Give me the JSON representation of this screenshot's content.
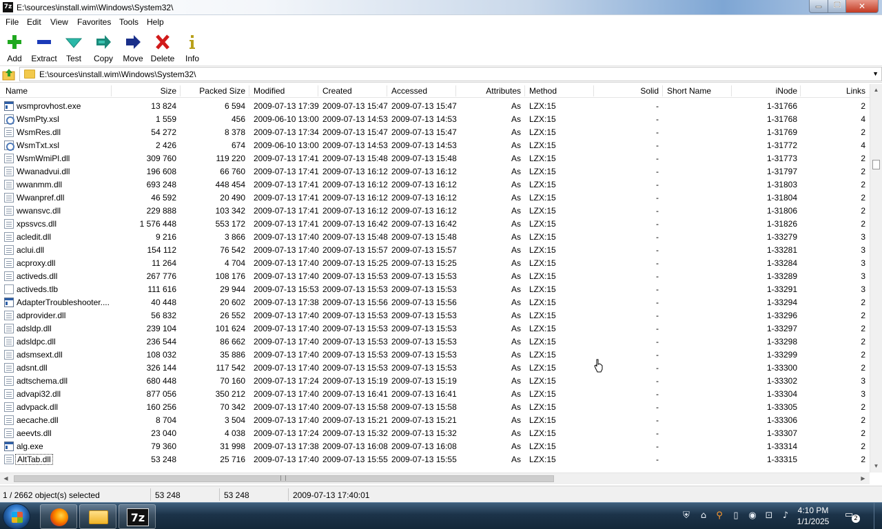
{
  "window": {
    "app_icon": "7z",
    "title": "E:\\sources\\install.wim\\Windows\\System32\\",
    "minimize_icon": "minimize-icon",
    "maximize_icon": "maximize-icon",
    "close_glyph": "✕"
  },
  "menu": [
    "File",
    "Edit",
    "View",
    "Favorites",
    "Tools",
    "Help"
  ],
  "toolbar": [
    {
      "label": "Add",
      "icon": "plus-icon",
      "color": "#1fa81f"
    },
    {
      "label": "Extract",
      "icon": "minus-icon",
      "color": "#1a3ab8"
    },
    {
      "label": "Test",
      "icon": "check-icon",
      "color": "#2ab8a8"
    },
    {
      "label": "Copy",
      "icon": "double-arrow-icon",
      "color": "#1a8a7a"
    },
    {
      "label": "Move",
      "icon": "arrow-right-icon",
      "color": "#1a2f8a"
    },
    {
      "label": "Delete",
      "icon": "x-icon",
      "color": "#d11a1a"
    },
    {
      "label": "Info",
      "icon": "info-icon",
      "color": "#b8a01a"
    }
  ],
  "address": {
    "path": "E:\\sources\\install.wim\\Windows\\System32\\",
    "dropdown_glyph": "▼"
  },
  "columns": [
    "Name",
    "Size",
    "Packed Size",
    "Modified",
    "Created",
    "Accessed",
    "Attributes",
    "Method",
    "Solid",
    "Short Name",
    "iNode",
    "Links"
  ],
  "files": [
    {
      "name": "wsmprovhost.exe",
      "type": "exe",
      "size": "13 824",
      "packed": "6 594",
      "modified": "2009-07-13 17:39",
      "created": "2009-07-13 15:47",
      "accessed": "2009-07-13 15:47",
      "attr": "As",
      "method": "LZX:15",
      "solid": "-",
      "inode": "1-31766",
      "links": "2"
    },
    {
      "name": "WsmPty.xsl",
      "type": "xsl",
      "size": "1 559",
      "packed": "456",
      "modified": "2009-06-10 13:00",
      "created": "2009-07-13 14:53",
      "accessed": "2009-07-13 14:53",
      "attr": "As",
      "method": "LZX:15",
      "solid": "-",
      "inode": "1-31768",
      "links": "4"
    },
    {
      "name": "WsmRes.dll",
      "type": "dll",
      "size": "54 272",
      "packed": "8 378",
      "modified": "2009-07-13 17:34",
      "created": "2009-07-13 15:47",
      "accessed": "2009-07-13 15:47",
      "attr": "As",
      "method": "LZX:15",
      "solid": "-",
      "inode": "1-31769",
      "links": "2"
    },
    {
      "name": "WsmTxt.xsl",
      "type": "xsl",
      "size": "2 426",
      "packed": "674",
      "modified": "2009-06-10 13:00",
      "created": "2009-07-13 14:53",
      "accessed": "2009-07-13 14:53",
      "attr": "As",
      "method": "LZX:15",
      "solid": "-",
      "inode": "1-31772",
      "links": "4"
    },
    {
      "name": "WsmWmiPl.dll",
      "type": "dll",
      "size": "309 760",
      "packed": "119 220",
      "modified": "2009-07-13 17:41",
      "created": "2009-07-13 15:48",
      "accessed": "2009-07-13 15:48",
      "attr": "As",
      "method": "LZX:15",
      "solid": "-",
      "inode": "1-31773",
      "links": "2"
    },
    {
      "name": "Wwanadvui.dll",
      "type": "dll",
      "size": "196 608",
      "packed": "66 760",
      "modified": "2009-07-13 17:41",
      "created": "2009-07-13 16:12",
      "accessed": "2009-07-13 16:12",
      "attr": "As",
      "method": "LZX:15",
      "solid": "-",
      "inode": "1-31797",
      "links": "2"
    },
    {
      "name": "wwanmm.dll",
      "type": "dll",
      "size": "693 248",
      "packed": "448 454",
      "modified": "2009-07-13 17:41",
      "created": "2009-07-13 16:12",
      "accessed": "2009-07-13 16:12",
      "attr": "As",
      "method": "LZX:15",
      "solid": "-",
      "inode": "1-31803",
      "links": "2"
    },
    {
      "name": "Wwanpref.dll",
      "type": "dll",
      "size": "46 592",
      "packed": "20 490",
      "modified": "2009-07-13 17:41",
      "created": "2009-07-13 16:12",
      "accessed": "2009-07-13 16:12",
      "attr": "As",
      "method": "LZX:15",
      "solid": "-",
      "inode": "1-31804",
      "links": "2"
    },
    {
      "name": "wwansvc.dll",
      "type": "dll",
      "size": "229 888",
      "packed": "103 342",
      "modified": "2009-07-13 17:41",
      "created": "2009-07-13 16:12",
      "accessed": "2009-07-13 16:12",
      "attr": "As",
      "method": "LZX:15",
      "solid": "-",
      "inode": "1-31806",
      "links": "2"
    },
    {
      "name": "xpssvcs.dll",
      "type": "dll",
      "size": "1 576 448",
      "packed": "553 172",
      "modified": "2009-07-13 17:41",
      "created": "2009-07-13 16:42",
      "accessed": "2009-07-13 16:42",
      "attr": "As",
      "method": "LZX:15",
      "solid": "-",
      "inode": "1-31826",
      "links": "2"
    },
    {
      "name": "acledit.dll",
      "type": "dll",
      "size": "9 216",
      "packed": "3 866",
      "modified": "2009-07-13 17:40",
      "created": "2009-07-13 15:48",
      "accessed": "2009-07-13 15:48",
      "attr": "As",
      "method": "LZX:15",
      "solid": "-",
      "inode": "1-33279",
      "links": "3"
    },
    {
      "name": "aclui.dll",
      "type": "dll",
      "size": "154 112",
      "packed": "76 542",
      "modified": "2009-07-13 17:40",
      "created": "2009-07-13 15:57",
      "accessed": "2009-07-13 15:57",
      "attr": "As",
      "method": "LZX:15",
      "solid": "-",
      "inode": "1-33281",
      "links": "3"
    },
    {
      "name": "acproxy.dll",
      "type": "dll",
      "size": "11 264",
      "packed": "4 704",
      "modified": "2009-07-13 17:40",
      "created": "2009-07-13 15:25",
      "accessed": "2009-07-13 15:25",
      "attr": "As",
      "method": "LZX:15",
      "solid": "-",
      "inode": "1-33284",
      "links": "3"
    },
    {
      "name": "activeds.dll",
      "type": "dll",
      "size": "267 776",
      "packed": "108 176",
      "modified": "2009-07-13 17:40",
      "created": "2009-07-13 15:53",
      "accessed": "2009-07-13 15:53",
      "attr": "As",
      "method": "LZX:15",
      "solid": "-",
      "inode": "1-33289",
      "links": "3"
    },
    {
      "name": "activeds.tlb",
      "type": "tlb",
      "size": "111 616",
      "packed": "29 944",
      "modified": "2009-07-13 15:53",
      "created": "2009-07-13 15:53",
      "accessed": "2009-07-13 15:53",
      "attr": "As",
      "method": "LZX:15",
      "solid": "-",
      "inode": "1-33291",
      "links": "3"
    },
    {
      "name": "AdapterTroubleshooter....",
      "type": "exe",
      "size": "40 448",
      "packed": "20 602",
      "modified": "2009-07-13 17:38",
      "created": "2009-07-13 15:56",
      "accessed": "2009-07-13 15:56",
      "attr": "As",
      "method": "LZX:15",
      "solid": "-",
      "inode": "1-33294",
      "links": "2"
    },
    {
      "name": "adprovider.dll",
      "type": "dll",
      "size": "56 832",
      "packed": "26 552",
      "modified": "2009-07-13 17:40",
      "created": "2009-07-13 15:53",
      "accessed": "2009-07-13 15:53",
      "attr": "As",
      "method": "LZX:15",
      "solid": "-",
      "inode": "1-33296",
      "links": "2"
    },
    {
      "name": "adsldp.dll",
      "type": "dll",
      "size": "239 104",
      "packed": "101 624",
      "modified": "2009-07-13 17:40",
      "created": "2009-07-13 15:53",
      "accessed": "2009-07-13 15:53",
      "attr": "As",
      "method": "LZX:15",
      "solid": "-",
      "inode": "1-33297",
      "links": "2"
    },
    {
      "name": "adsldpc.dll",
      "type": "dll",
      "size": "236 544",
      "packed": "86 662",
      "modified": "2009-07-13 17:40",
      "created": "2009-07-13 15:53",
      "accessed": "2009-07-13 15:53",
      "attr": "As",
      "method": "LZX:15",
      "solid": "-",
      "inode": "1-33298",
      "links": "2"
    },
    {
      "name": "adsmsext.dll",
      "type": "dll",
      "size": "108 032",
      "packed": "35 886",
      "modified": "2009-07-13 17:40",
      "created": "2009-07-13 15:53",
      "accessed": "2009-07-13 15:53",
      "attr": "As",
      "method": "LZX:15",
      "solid": "-",
      "inode": "1-33299",
      "links": "2"
    },
    {
      "name": "adsnt.dll",
      "type": "dll",
      "size": "326 144",
      "packed": "117 542",
      "modified": "2009-07-13 17:40",
      "created": "2009-07-13 15:53",
      "accessed": "2009-07-13 15:53",
      "attr": "As",
      "method": "LZX:15",
      "solid": "-",
      "inode": "1-33300",
      "links": "2"
    },
    {
      "name": "adtschema.dll",
      "type": "dll",
      "size": "680 448",
      "packed": "70 160",
      "modified": "2009-07-13 17:24",
      "created": "2009-07-13 15:19",
      "accessed": "2009-07-13 15:19",
      "attr": "As",
      "method": "LZX:15",
      "solid": "-",
      "inode": "1-33302",
      "links": "3"
    },
    {
      "name": "advapi32.dll",
      "type": "dll",
      "size": "877 056",
      "packed": "350 212",
      "modified": "2009-07-13 17:40",
      "created": "2009-07-13 16:41",
      "accessed": "2009-07-13 16:41",
      "attr": "As",
      "method": "LZX:15",
      "solid": "-",
      "inode": "1-33304",
      "links": "3"
    },
    {
      "name": "advpack.dll",
      "type": "dll",
      "size": "160 256",
      "packed": "70 342",
      "modified": "2009-07-13 17:40",
      "created": "2009-07-13 15:58",
      "accessed": "2009-07-13 15:58",
      "attr": "As",
      "method": "LZX:15",
      "solid": "-",
      "inode": "1-33305",
      "links": "2"
    },
    {
      "name": "aecache.dll",
      "type": "dll",
      "size": "8 704",
      "packed": "3 504",
      "modified": "2009-07-13 17:40",
      "created": "2009-07-13 15:21",
      "accessed": "2009-07-13 15:21",
      "attr": "As",
      "method": "LZX:15",
      "solid": "-",
      "inode": "1-33306",
      "links": "2"
    },
    {
      "name": "aeevts.dll",
      "type": "dll",
      "size": "23 040",
      "packed": "4 038",
      "modified": "2009-07-13 17:24",
      "created": "2009-07-13 15:32",
      "accessed": "2009-07-13 15:32",
      "attr": "As",
      "method": "LZX:15",
      "solid": "-",
      "inode": "1-33307",
      "links": "2"
    },
    {
      "name": "alg.exe",
      "type": "exe",
      "size": "79 360",
      "packed": "31 998",
      "modified": "2009-07-13 17:38",
      "created": "2009-07-13 16:08",
      "accessed": "2009-07-13 16:08",
      "attr": "As",
      "method": "LZX:15",
      "solid": "-",
      "inode": "1-33314",
      "links": "2"
    },
    {
      "name": "AltTab.dll",
      "type": "dll",
      "size": "53 248",
      "packed": "25 716",
      "modified": "2009-07-13 17:40",
      "created": "2009-07-13 15:55",
      "accessed": "2009-07-13 15:55",
      "attr": "As",
      "method": "LZX:15",
      "solid": "-",
      "inode": "1-33315",
      "links": "2",
      "selected": true
    }
  ],
  "status": {
    "selection": "1 / 2662 object(s) selected",
    "size": "53 248",
    "packed": "53 248",
    "modified": "2009-07-13 17:40:01"
  },
  "scroll": {
    "up_glyph": "▲",
    "down_glyph": "▼",
    "left_glyph": "◀",
    "right_glyph": "▶"
  },
  "taskbar": {
    "apps": [
      {
        "name": "firefox",
        "icon": "firefox-icon"
      },
      {
        "name": "explorer",
        "icon": "folder-icon"
      },
      {
        "name": "7zip",
        "icon": "7zip-icon",
        "label": "7z"
      }
    ],
    "tray": [
      {
        "icon": "shield-icon",
        "glyph": "⛨"
      },
      {
        "icon": "network-share-icon",
        "glyph": "⌂"
      },
      {
        "icon": "search-icon",
        "glyph": "⚲"
      },
      {
        "icon": "battery-icon",
        "glyph": "▯"
      },
      {
        "icon": "camera-icon",
        "glyph": "◉"
      },
      {
        "icon": "network-icon",
        "glyph": "⊡"
      },
      {
        "icon": "volume-muted-icon",
        "glyph": "♪"
      }
    ],
    "time": "4:10 PM",
    "date": "1/1/2025",
    "notifications": "2"
  }
}
